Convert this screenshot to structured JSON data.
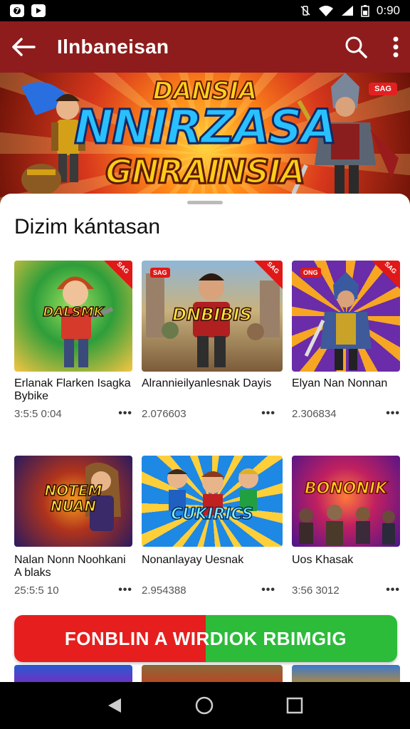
{
  "status_bar": {
    "time": "0:90"
  },
  "app_bar": {
    "title": "Ilnbaneisan"
  },
  "banner": {
    "title_top": "DANSIA",
    "title_main": "NNIRZASA",
    "title_sub": "GNRAINSIA",
    "badge": "SAG"
  },
  "section": {
    "title": "Dizim kántasan"
  },
  "games": [
    {
      "title": "Erlanak Flarken Isagka Bybike",
      "meta": "3:5:5 0:04",
      "logo": "DALSMK",
      "colors": [
        "#2e7d32",
        "#f5c542"
      ],
      "ribbon": "SAG"
    },
    {
      "title": "Alrannieilyanlesnak Dayis",
      "meta": "2.076603",
      "logo": "DNBIBIS",
      "colors": [
        "#7b5b3a",
        "#c9b27d"
      ],
      "ribbon": "SAG",
      "badge": "SAG"
    },
    {
      "title": "Elyan Nan Nonnan",
      "meta": "2.306834",
      "logo": "",
      "colors": [
        "#6a2ca8",
        "#f6a623"
      ],
      "ribbon": "SAG",
      "badge": "ONG"
    },
    {
      "title": "Nalan Nonn Noohkani A blaks",
      "meta": "25:5:5 10",
      "logo": "NOTEM NUAN",
      "colors": [
        "#2a1a5e",
        "#f59b1e"
      ],
      "ribbon": ""
    },
    {
      "title": "Nonanlayay Uesnak",
      "meta": "2.954388",
      "logo": "CUKIRICS",
      "colors": [
        "#1e88e5",
        "#ff9f1c"
      ],
      "ribbon": ""
    },
    {
      "title": "Uos Khasak",
      "meta": "3:56 3012",
      "logo": "BONONIK",
      "colors": [
        "#4a148c",
        "#ff5252"
      ],
      "ribbon": ""
    }
  ],
  "cta": {
    "label": "FONBLIN A WIRDIOK RBIMGIG"
  },
  "colors": {
    "app_bar": "#8e1c1c",
    "cta_left": "#e61e1e",
    "cta_right": "#2dbb3a"
  }
}
